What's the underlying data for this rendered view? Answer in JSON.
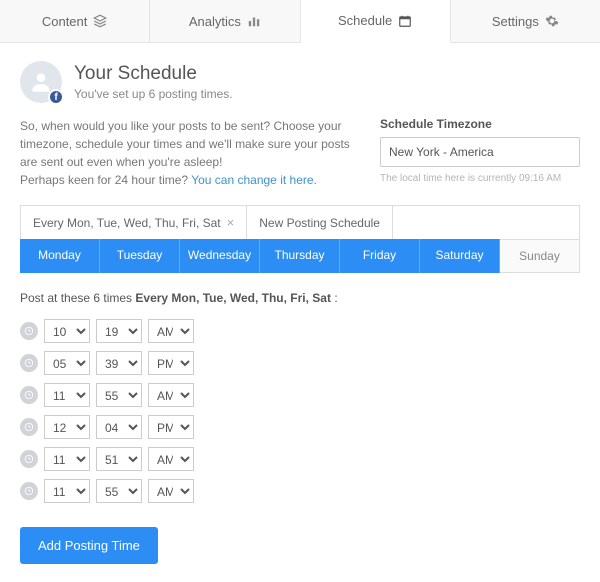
{
  "tabs": {
    "content": "Content",
    "analytics": "Analytics",
    "schedule": "Schedule",
    "settings": "Settings"
  },
  "header": {
    "title": "Your Schedule",
    "subtitle": "You've set up 6 posting times."
  },
  "intro": {
    "line1": "So, when would you like your posts to be sent? Choose your timezone, schedule your times and we'll make sure your posts are sent out even when you're asleep!",
    "line2_prefix": "Perhaps keen for 24 hour time? ",
    "line2_link": "You can change it here."
  },
  "timezone": {
    "label": "Schedule Timezone",
    "value": "New York - America",
    "note": "The local time here is currently 09:16 AM"
  },
  "schedule_tabs": {
    "current": "Every Mon, Tue, Wed, Thu, Fri, Sat",
    "new": "New Posting Schedule"
  },
  "days": [
    "Monday",
    "Tuesday",
    "Wednesday",
    "Thursday",
    "Friday",
    "Saturday",
    "Sunday"
  ],
  "post_label_prefix": "Post at these 6 times ",
  "post_label_bold": "Every Mon, Tue, Wed, Thu, Fri, Sat",
  "post_label_suffix": " :",
  "times": [
    {
      "h": "10",
      "m": "19",
      "ap": "AM"
    },
    {
      "h": "05",
      "m": "39",
      "ap": "PM"
    },
    {
      "h": "11",
      "m": "55",
      "ap": "AM"
    },
    {
      "h": "12",
      "m": "04",
      "ap": "PM"
    },
    {
      "h": "11",
      "m": "51",
      "ap": "AM"
    },
    {
      "h": "11",
      "m": "55",
      "ap": "AM"
    }
  ],
  "add_button": "Add Posting Time"
}
